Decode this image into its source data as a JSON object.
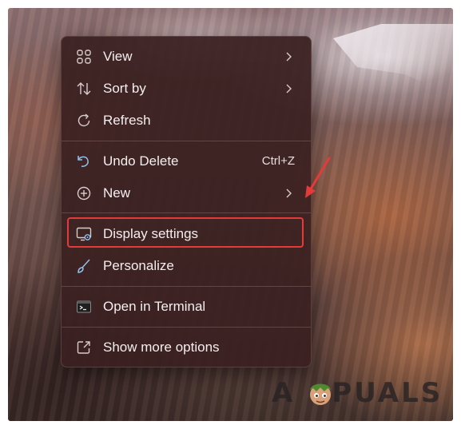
{
  "context_menu": {
    "items": [
      {
        "label": "View",
        "icon": "grid-icon",
        "has_submenu": true
      },
      {
        "label": "Sort by",
        "icon": "sort-icon",
        "has_submenu": true
      },
      {
        "label": "Refresh",
        "icon": "refresh-icon",
        "has_submenu": false
      },
      {
        "label": "Undo Delete",
        "icon": "undo-icon",
        "shortcut": "Ctrl+Z"
      },
      {
        "label": "New",
        "icon": "plus-circle-icon",
        "has_submenu": true
      },
      {
        "label": "Display settings",
        "icon": "display-settings-icon",
        "highlighted": true
      },
      {
        "label": "Personalize",
        "icon": "brush-icon"
      },
      {
        "label": "Open in Terminal",
        "icon": "terminal-icon"
      },
      {
        "label": "Show more options",
        "icon": "expand-icon"
      }
    ]
  },
  "annotation": {
    "highlight_color": "#e53a3a",
    "arrow_color": "#e53a3a"
  },
  "watermark": {
    "text_left": "A",
    "text_right": "PUALS"
  },
  "colors": {
    "menu_background": "#3a2020",
    "menu_text": "#f4eeee",
    "icon_color": "#d8cccc",
    "accent_icon": "#8fc2ef"
  }
}
